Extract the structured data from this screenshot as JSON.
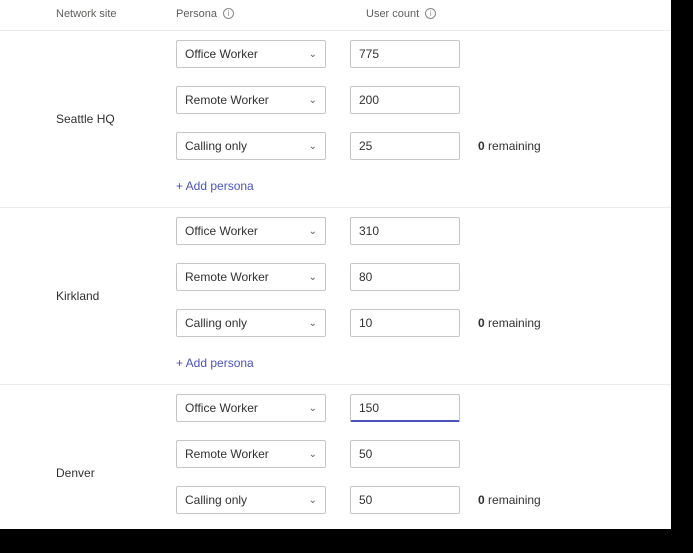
{
  "headers": {
    "site": "Network site",
    "persona": "Persona",
    "count": "User count"
  },
  "info_glyph": "i",
  "add_persona_label": "+ Add persona",
  "remaining_suffix": " remaining",
  "sites": [
    {
      "name": "Seattle HQ",
      "rows": [
        {
          "persona": "Office Worker",
          "count": "775",
          "focused": false
        },
        {
          "persona": "Remote Worker",
          "count": "200",
          "focused": false
        },
        {
          "persona": "Calling only",
          "count": "25",
          "focused": false
        }
      ],
      "remaining": "0"
    },
    {
      "name": "Kirkland",
      "rows": [
        {
          "persona": "Office Worker",
          "count": "310",
          "focused": false
        },
        {
          "persona": "Remote Worker",
          "count": "80",
          "focused": false
        },
        {
          "persona": "Calling only",
          "count": "10",
          "focused": false
        }
      ],
      "remaining": "0"
    },
    {
      "name": "Denver",
      "rows": [
        {
          "persona": "Office Worker",
          "count": "150",
          "focused": true
        },
        {
          "persona": "Remote Worker",
          "count": "50",
          "focused": false
        },
        {
          "persona": "Calling only",
          "count": "50",
          "focused": false
        }
      ],
      "remaining": "0"
    }
  ]
}
